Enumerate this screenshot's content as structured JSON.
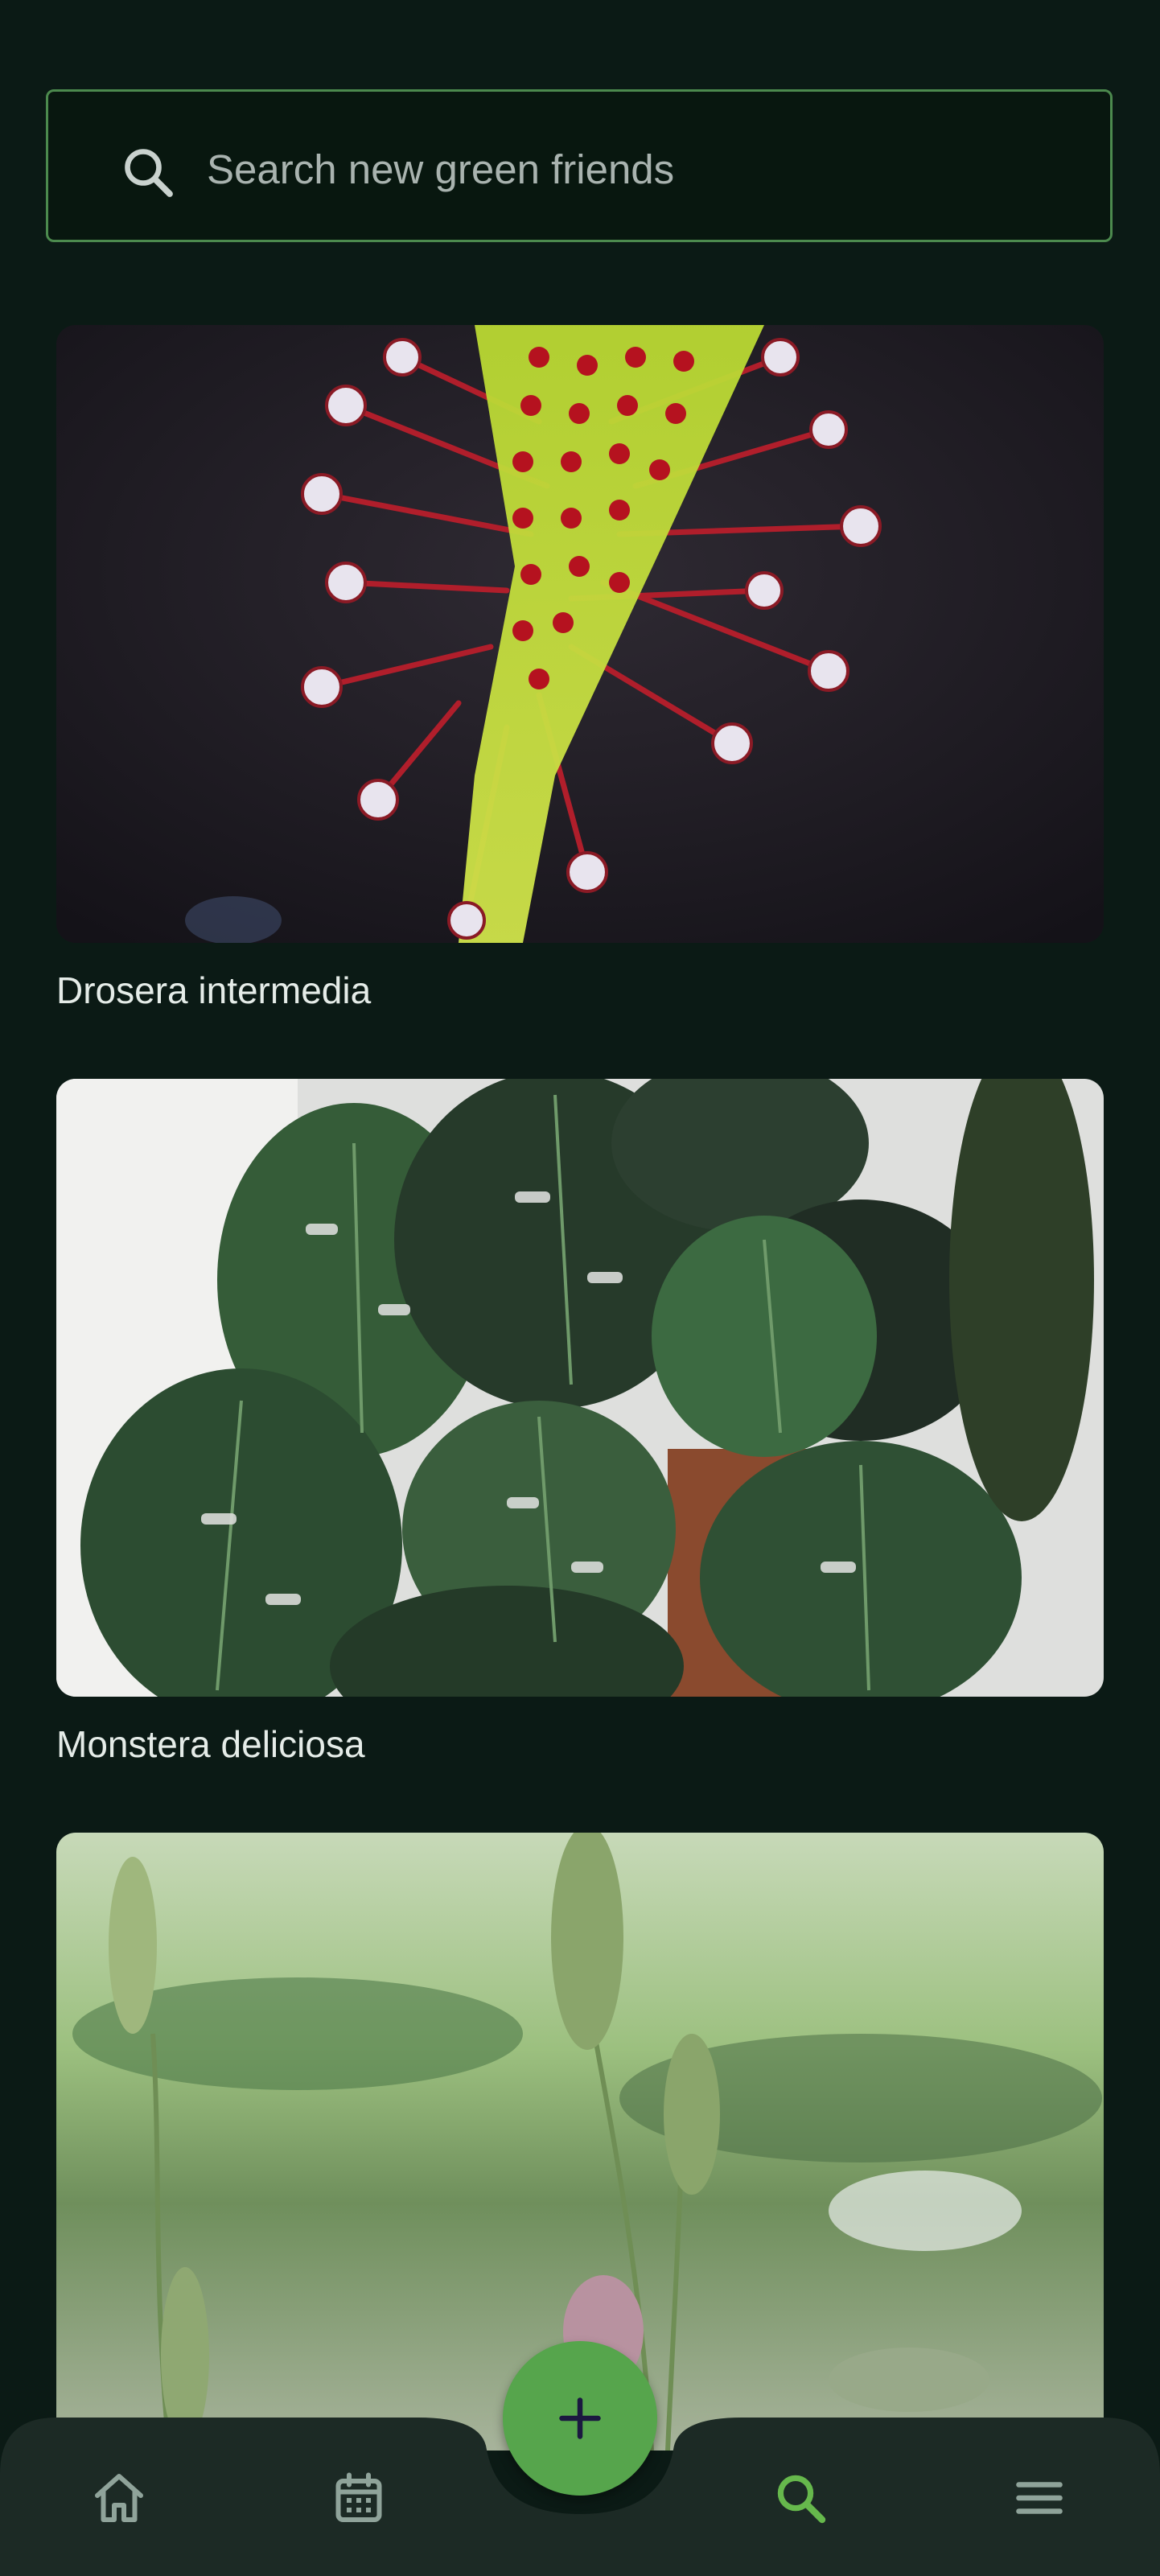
{
  "search": {
    "placeholder": "Search new green friends",
    "value": "",
    "icon": "search-icon"
  },
  "plants": [
    {
      "name": "Drosera intermedia"
    },
    {
      "name": "Monstera deliciosa"
    },
    {
      "name": ""
    }
  ],
  "fab": {
    "icon": "add-icon",
    "color": "#56a54c"
  },
  "nav": {
    "items": [
      {
        "icon": "home-icon",
        "active": false
      },
      {
        "icon": "calendar-icon",
        "active": false
      },
      {
        "icon": "search-icon",
        "active": true
      },
      {
        "icon": "menu-icon",
        "active": false
      }
    ],
    "active_color": "#66b84c",
    "inactive_color": "#8fa39a"
  }
}
